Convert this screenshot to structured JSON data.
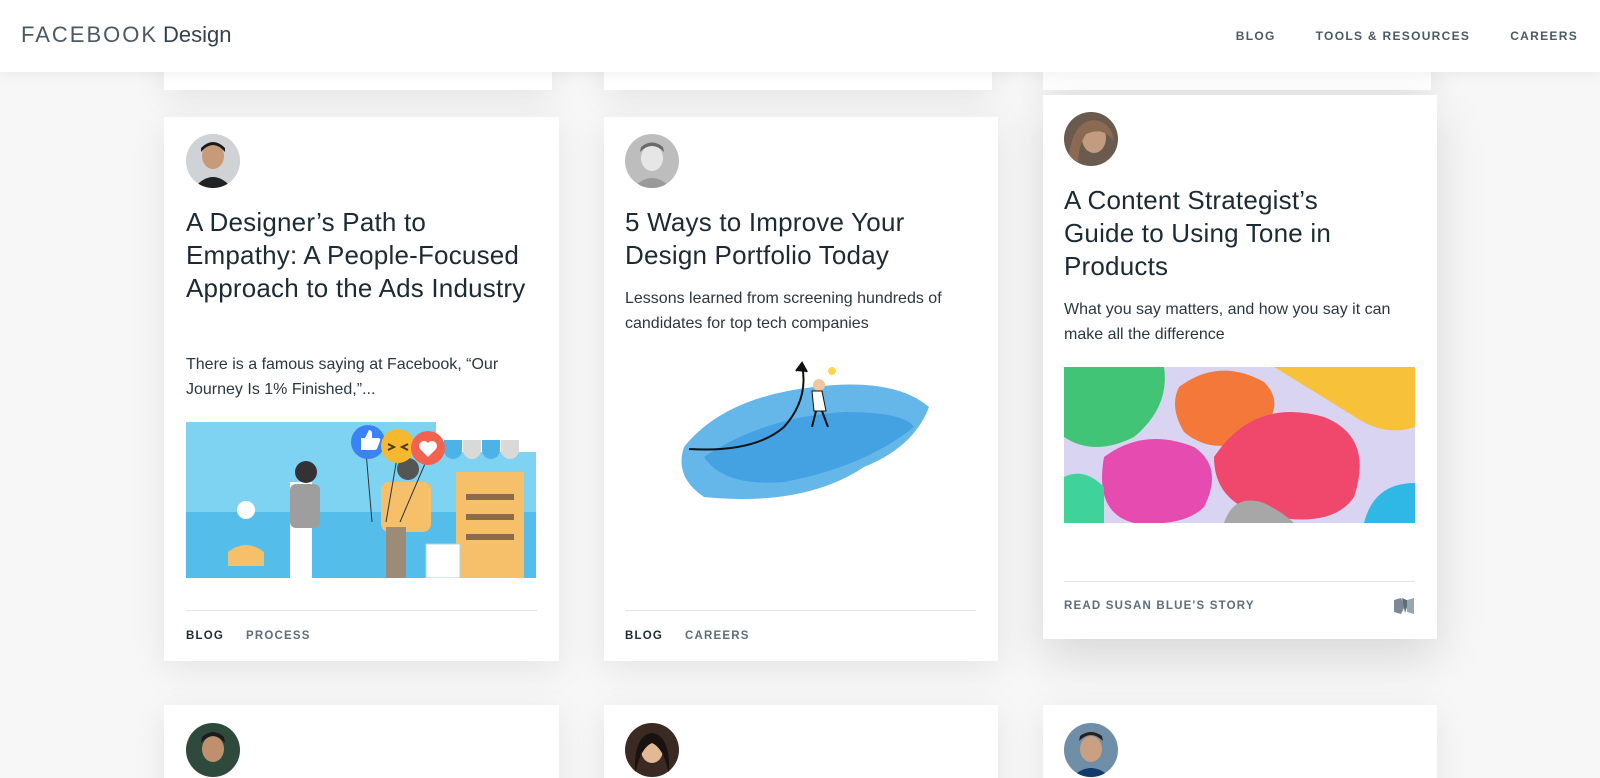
{
  "header": {
    "logo_brand": "FACEBOOK",
    "logo_design": "Design",
    "nav": [
      "BLOG",
      "TOOLS & RESOURCES",
      "CAREERS"
    ]
  },
  "cards": [
    {
      "title": "A Designer’s Path to Empathy: A People-Focused Approach to the Ads Industry",
      "summary": "There is a famous saying at Facebook, “Our Journey Is 1% Finished,”...",
      "tags": [
        "BLOG",
        "PROCESS"
      ],
      "illustration": "people-ads-illustration"
    },
    {
      "title": "5 Ways to Improve Your Design Portfolio Today",
      "summary": "Lessons learned from screening hundreds of candidates for top tech companies",
      "tags": [
        "BLOG",
        "CAREERS"
      ],
      "illustration": "rocket-arrow-illustration"
    },
    {
      "title": "A Content Strategist’s Guide to Using Tone in Products",
      "summary": "What you say matters, and how you say it can make all the difference",
      "footer_link": "READ SUSAN BLUE'S STORY",
      "footer_icon": "medium-icon",
      "illustration": "colorful-blobs-illustration"
    }
  ],
  "colors": {
    "text": "#1c2b33",
    "muted": "#5c6e7a",
    "background": "#f7f7f8",
    "accent_blue": "#4fb7e8"
  }
}
